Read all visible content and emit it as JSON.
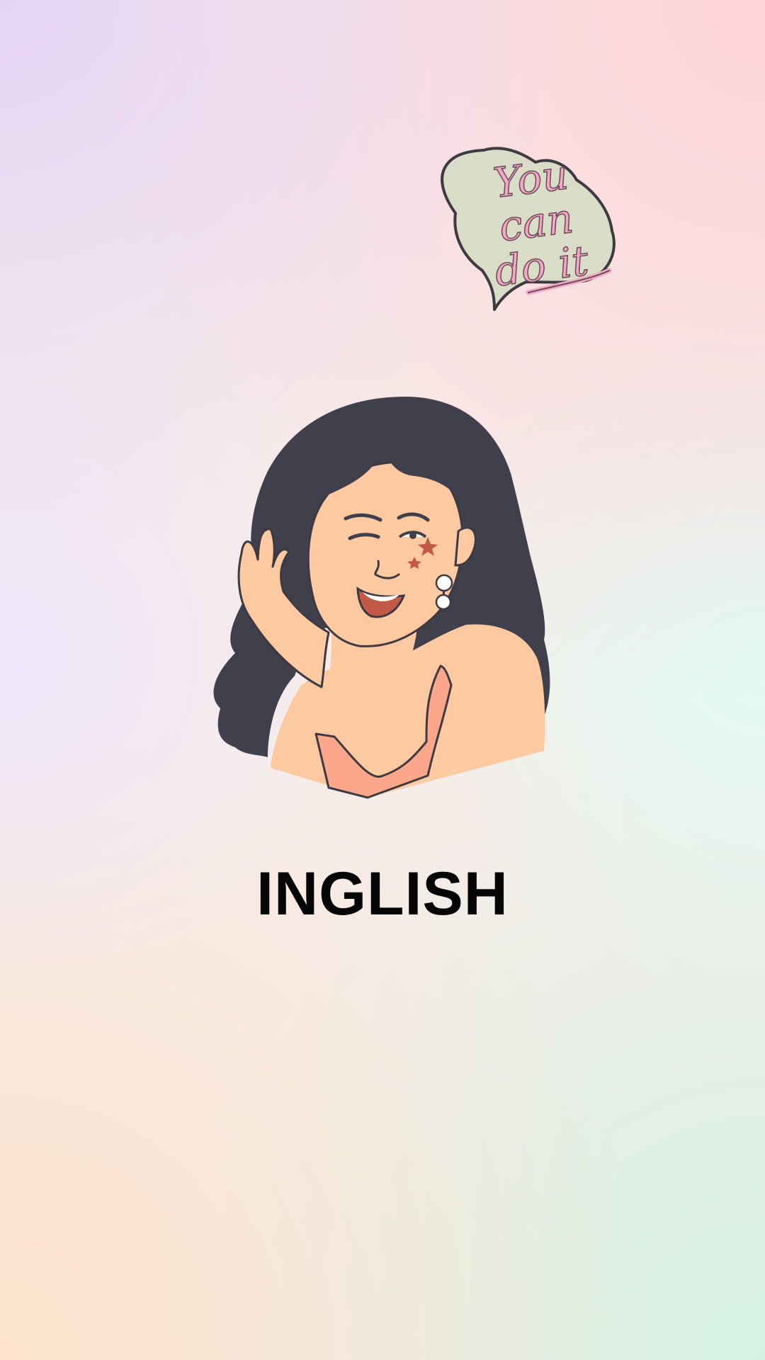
{
  "app": {
    "title": "INGLISH"
  },
  "sticker": {
    "lines": [
      "You",
      "can",
      "do it"
    ],
    "icon": "speech-bubble-icon"
  },
  "illustration": {
    "icon": "smiling-woman-illustration"
  },
  "colors": {
    "hair": "#40404d",
    "skin": "#fdc9a1",
    "top": "#fca78c",
    "lips": "#c25a47",
    "sticker_fill": "#d9dcc6",
    "sticker_text": "#f4a8c7",
    "outline": "#3e3a42",
    "title": "#050505"
  }
}
